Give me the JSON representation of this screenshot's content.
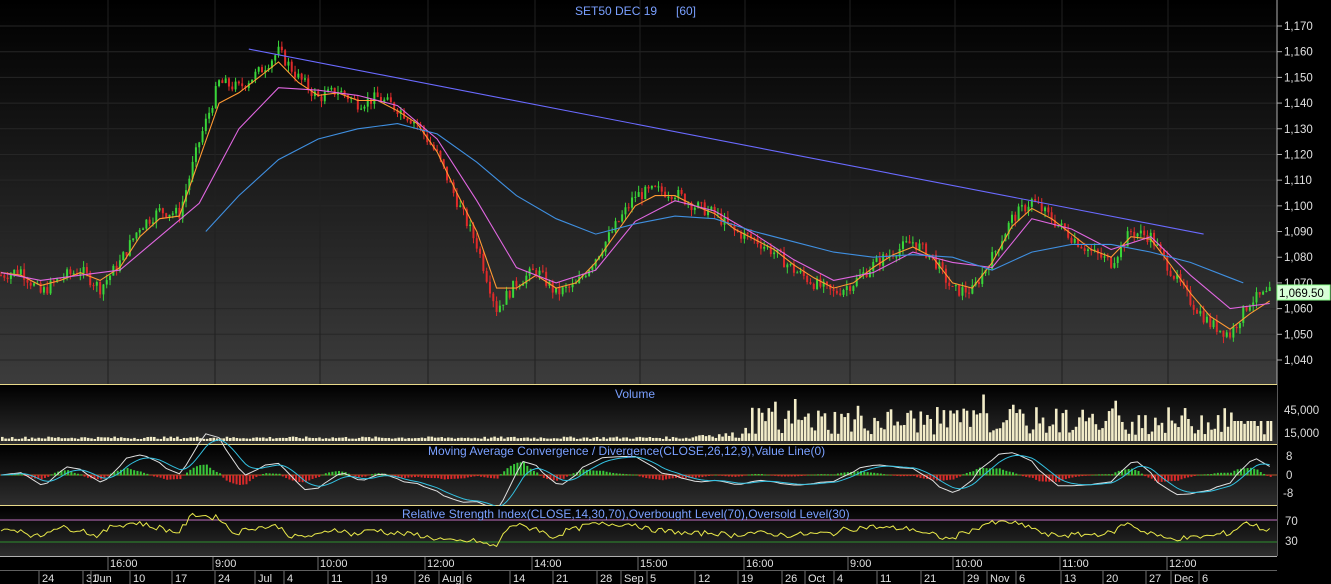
{
  "chart_data": [
    {
      "type": "line",
      "title": "SET50 DEC 19",
      "interval": "[60]",
      "price_badge": "1,069.50",
      "y_ticks": [
        "1,170",
        "1,160",
        "1,150",
        "1,140",
        "1,130",
        "1,120",
        "1,110",
        "1,100",
        "1,090",
        "1,080",
        "1,070",
        "1,060",
        "1,050",
        "1,040"
      ],
      "ylim": [
        1035,
        1172
      ],
      "series": [
        {
          "color": "#ffffff",
          "points": [
            [
              0,
              1073
            ],
            [
              6,
              1075
            ],
            [
              12,
              1066
            ],
            [
              18,
              1072
            ],
            [
              24,
              1075
            ],
            [
              30,
              1068
            ],
            [
              36,
              1078
            ],
            [
              42,
              1092
            ],
            [
              48,
              1098
            ],
            [
              54,
              1097
            ],
            [
              60,
              1125
            ],
            [
              66,
              1148
            ],
            [
              72,
              1146
            ],
            [
              78,
              1152
            ],
            [
              84,
              1160
            ],
            [
              90,
              1150
            ],
            [
              96,
              1142
            ],
            [
              102,
              1145
            ],
            [
              108,
              1140
            ],
            [
              114,
              1142
            ],
            [
              120,
              1138
            ],
            [
              126,
              1132
            ],
            [
              132,
              1120
            ],
            [
              138,
              1102
            ],
            [
              144,
              1085
            ],
            [
              150,
              1060
            ],
            [
              156,
              1070
            ],
            [
              162,
              1075
            ],
            [
              168,
              1066
            ],
            [
              174,
              1069
            ],
            [
              180,
              1080
            ],
            [
              186,
              1092
            ],
            [
              192,
              1104
            ],
            [
              198,
              1106
            ],
            [
              204,
              1105
            ],
            [
              210,
              1100
            ],
            [
              216,
              1097
            ],
            [
              222,
              1090
            ],
            [
              228,
              1087
            ],
            [
              234,
              1082
            ],
            [
              240,
              1075
            ],
            [
              246,
              1070
            ],
            [
              252,
              1066
            ],
            [
              258,
              1070
            ],
            [
              264,
              1077
            ],
            [
              270,
              1082
            ],
            [
              276,
              1086
            ],
            [
              282,
              1080
            ],
            [
              288,
              1067
            ],
            [
              294,
              1067
            ],
            [
              300,
              1080
            ],
            [
              306,
              1095
            ],
            [
              312,
              1102
            ],
            [
              318,
              1095
            ],
            [
              324,
              1088
            ],
            [
              330,
              1082
            ],
            [
              336,
              1078
            ],
            [
              342,
              1090
            ],
            [
              348,
              1088
            ],
            [
              354,
              1075
            ],
            [
              360,
              1063
            ],
            [
              366,
              1054
            ],
            [
              372,
              1050
            ],
            [
              378,
              1063
            ],
            [
              384,
              1066
            ]
          ]
        },
        {
          "color": "#ff9933",
          "points": [
            [
              0,
              1074
            ],
            [
              6,
              1073
            ],
            [
              12,
              1069
            ],
            [
              18,
              1071
            ],
            [
              24,
              1074
            ],
            [
              30,
              1071
            ],
            [
              36,
              1076
            ],
            [
              42,
              1088
            ],
            [
              48,
              1095
            ],
            [
              54,
              1096
            ],
            [
              60,
              1118
            ],
            [
              66,
              1140
            ],
            [
              72,
              1144
            ],
            [
              78,
              1150
            ],
            [
              84,
              1156
            ],
            [
              90,
              1148
            ],
            [
              96,
              1143
            ],
            [
              102,
              1144
            ],
            [
              108,
              1141
            ],
            [
              114,
              1141
            ],
            [
              120,
              1137
            ],
            [
              126,
              1132
            ],
            [
              132,
              1121
            ],
            [
              138,
              1105
            ],
            [
              144,
              1090
            ],
            [
              150,
              1068
            ],
            [
              156,
              1068
            ],
            [
              162,
              1073
            ],
            [
              168,
              1068
            ],
            [
              174,
              1070
            ],
            [
              180,
              1078
            ],
            [
              186,
              1089
            ],
            [
              192,
              1100
            ],
            [
              198,
              1104
            ],
            [
              204,
              1104
            ],
            [
              210,
              1100
            ],
            [
              216,
              1097
            ],
            [
              222,
              1091
            ],
            [
              228,
              1087
            ],
            [
              234,
              1083
            ],
            [
              240,
              1077
            ],
            [
              246,
              1072
            ],
            [
              252,
              1068
            ],
            [
              258,
              1070
            ],
            [
              264,
              1076
            ],
            [
              270,
              1081
            ],
            [
              276,
              1084
            ],
            [
              282,
              1080
            ],
            [
              288,
              1070
            ],
            [
              294,
              1068
            ],
            [
              300,
              1078
            ],
            [
              306,
              1092
            ],
            [
              312,
              1099
            ],
            [
              318,
              1095
            ],
            [
              324,
              1089
            ],
            [
              330,
              1083
            ],
            [
              336,
              1080
            ],
            [
              342,
              1088
            ],
            [
              348,
              1087
            ],
            [
              354,
              1077
            ],
            [
              360,
              1066
            ],
            [
              366,
              1057
            ],
            [
              372,
              1052
            ],
            [
              378,
              1058
            ],
            [
              384,
              1063
            ]
          ]
        },
        {
          "color": "#e066e0",
          "points": [
            [
              0,
              1074
            ],
            [
              12,
              1071
            ],
            [
              24,
              1073
            ],
            [
              36,
              1075
            ],
            [
              48,
              1088
            ],
            [
              60,
              1101
            ],
            [
              72,
              1130
            ],
            [
              84,
              1146
            ],
            [
              96,
              1145
            ],
            [
              108,
              1143
            ],
            [
              120,
              1139
            ],
            [
              132,
              1126
            ],
            [
              144,
              1102
            ],
            [
              156,
              1076
            ],
            [
              168,
              1070
            ],
            [
              180,
              1075
            ],
            [
              192,
              1094
            ],
            [
              204,
              1102
            ],
            [
              216,
              1098
            ],
            [
              228,
              1089
            ],
            [
              240,
              1079
            ],
            [
              252,
              1071
            ],
            [
              264,
              1074
            ],
            [
              276,
              1082
            ],
            [
              288,
              1078
            ],
            [
              300,
              1076
            ],
            [
              312,
              1095
            ],
            [
              324,
              1091
            ],
            [
              336,
              1083
            ],
            [
              348,
              1088
            ],
            [
              360,
              1073
            ],
            [
              372,
              1060
            ],
            [
              384,
              1062
            ]
          ]
        },
        {
          "color": "#3f8fe0",
          "points": [
            [
              62,
              1090
            ],
            [
              72,
              1104
            ],
            [
              84,
              1118
            ],
            [
              96,
              1126
            ],
            [
              108,
              1130
            ],
            [
              120,
              1132
            ],
            [
              132,
              1128
            ],
            [
              144,
              1117
            ],
            [
              156,
              1104
            ],
            [
              168,
              1095
            ],
            [
              180,
              1089
            ],
            [
              192,
              1093
            ],
            [
              204,
              1096
            ],
            [
              216,
              1095
            ],
            [
              228,
              1090
            ],
            [
              240,
              1086
            ],
            [
              252,
              1082
            ],
            [
              264,
              1080
            ],
            [
              276,
              1081
            ],
            [
              288,
              1080
            ],
            [
              300,
              1075
            ],
            [
              312,
              1082
            ],
            [
              324,
              1085
            ],
            [
              336,
              1085
            ],
            [
              348,
              1082
            ],
            [
              360,
              1078
            ],
            [
              372,
              1072
            ],
            [
              376,
              1070
            ]
          ]
        },
        {
          "color": "#6a6aff",
          "points": [
            [
              75,
              1161
            ],
            [
              364,
              1089
            ]
          ]
        }
      ]
    },
    {
      "type": "bar",
      "title": "Volume",
      "y_ticks": [
        "45,000",
        "15,000"
      ]
    },
    {
      "type": "line",
      "title": "Moving Average Convergence / Divergence(CLOSE,26,12,9),Value Line(0)",
      "y_ticks": [
        "8",
        "0",
        "-8"
      ]
    },
    {
      "type": "line",
      "title": "Relative Strength Index(CLOSE,14,30,70),Overbought Level(70),Oversold Level(30)",
      "y_ticks": [
        "70",
        "30"
      ]
    }
  ],
  "time_axis": {
    "upper_labels": [
      "16:00",
      "9:00",
      "10:00",
      "12:00",
      "14:00",
      "15:00",
      "16:00",
      "9:00",
      "10:00",
      "11:00",
      "12:00"
    ],
    "lower_labels": [
      "24",
      "31",
      "Jun",
      "10",
      "17",
      "24",
      "Jul",
      "4",
      "11",
      "19",
      "26",
      "Aug",
      "6",
      "14",
      "21",
      "28",
      "Sep",
      "5",
      "12",
      "19",
      "26",
      "Oct",
      "4",
      "11",
      "21",
      "29",
      "Nov",
      "6",
      "13",
      "20",
      "27",
      "Dec",
      "6"
    ]
  }
}
